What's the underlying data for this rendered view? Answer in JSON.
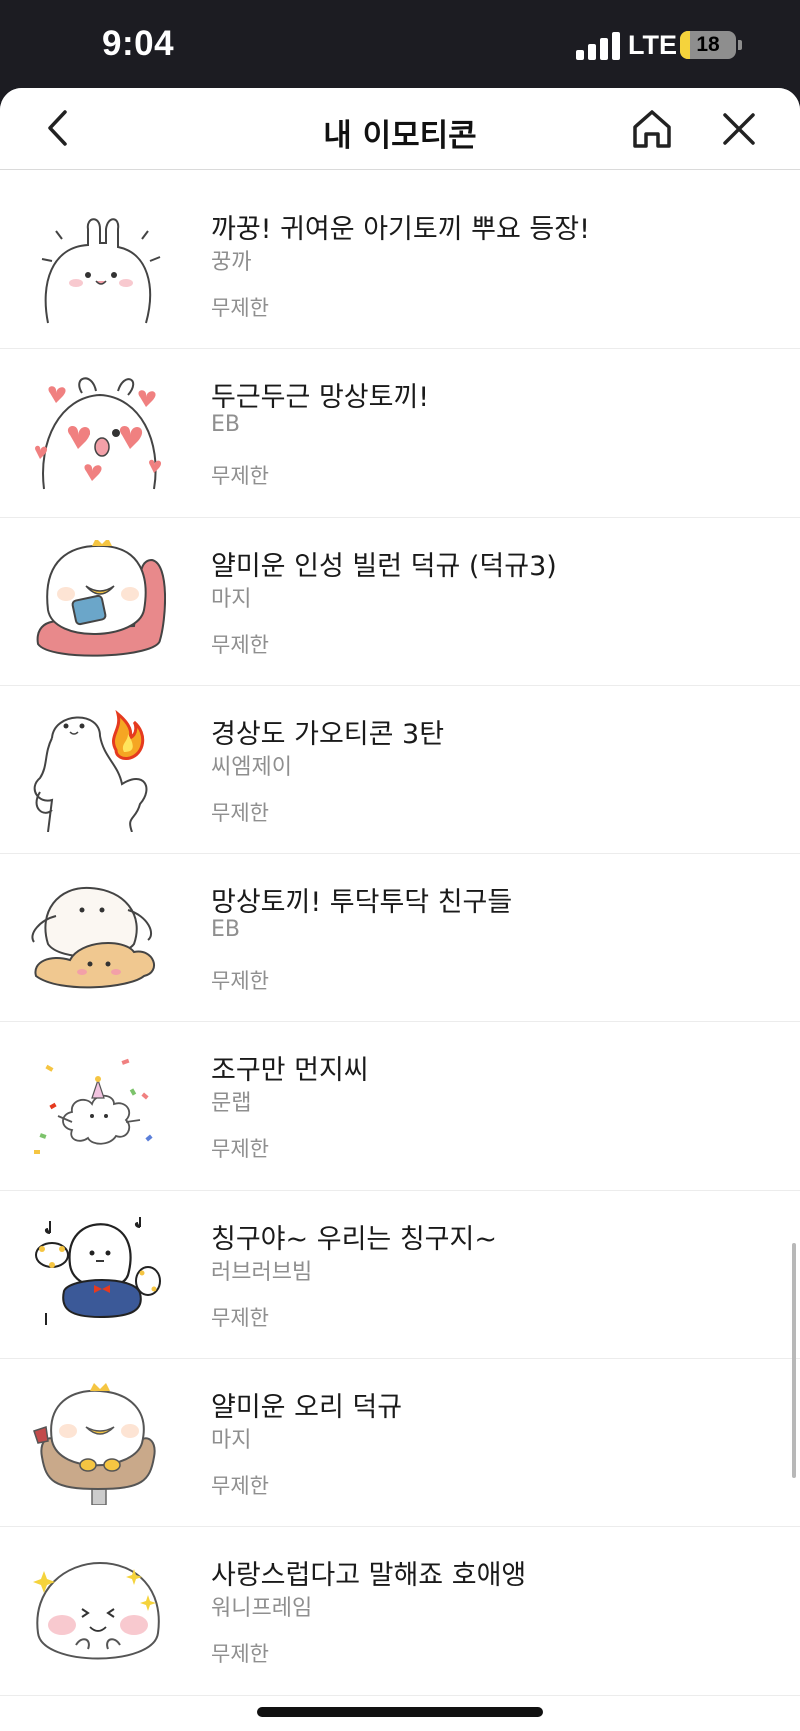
{
  "status_bar": {
    "time": "9:04",
    "network": "LTE",
    "battery": "18",
    "battery_level_percent": 18
  },
  "nav": {
    "title": "내 이모티콘",
    "back_icon": "chevron-left-icon",
    "home_icon": "home-icon",
    "close_icon": "close-icon"
  },
  "items": [
    {
      "title": "까꿍! 귀여운 아기토끼 뿌요 등장!",
      "author": "꿍까",
      "duration": "무제한",
      "icon": "baby-rabbit-icon"
    },
    {
      "title": "두근두근 망상토끼!",
      "author": "EB",
      "duration": "무제한",
      "icon": "rabbit-hearts-icon"
    },
    {
      "title": "얄미운 인성 빌런 덕규 (덕규3)",
      "author": "마지",
      "duration": "무제한",
      "icon": "duck-on-cushion-icon"
    },
    {
      "title": "경상도 가오티콘 3탄",
      "author": "씨엠제이",
      "duration": "무제한",
      "icon": "flexing-character-icon"
    },
    {
      "title": "망상토끼! 투닥투닥 친구들",
      "author": "EB",
      "duration": "무제한",
      "icon": "rabbit-friends-icon"
    },
    {
      "title": "조구만 먼지씨",
      "author": "문랩",
      "duration": "무제한",
      "icon": "dust-party-icon"
    },
    {
      "title": "칭구야~ 우리는 칭구지~",
      "author": "러브러브빔",
      "duration": "무제한",
      "icon": "tambourine-character-icon"
    },
    {
      "title": "얄미운 오리 덕규",
      "author": "마지",
      "duration": "무제한",
      "icon": "duck-in-chair-icon"
    },
    {
      "title": "사랑스럽다고 말해죠 호애앵",
      "author": "워니프레임",
      "duration": "무제한",
      "icon": "blushing-character-icon"
    }
  ],
  "colors": {
    "status_bar_bg": "#1c1c22",
    "battery_accent": "#f5d33c",
    "text_primary": "#1a1a1a",
    "text_secondary": "#8f8f8f"
  }
}
